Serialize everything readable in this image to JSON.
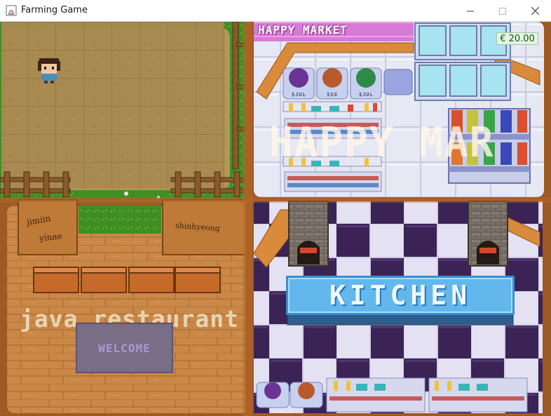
{
  "window": {
    "title": "Farming Game",
    "icon": "java-app-icon",
    "controls": [
      "minimize",
      "maximize",
      "close"
    ]
  },
  "hud": {
    "money": "€ 20.00"
  },
  "farm": {
    "grid_cols": 7,
    "grid_rows": 5,
    "player": "farmer-character"
  },
  "market": {
    "sign": "HAPPY MARKET",
    "overlay_label": "HAPPY MARKET",
    "overlay_visible": "HAPPY MAR",
    "price_tags": [
      "$JUL",
      "$SO",
      "$JUL"
    ]
  },
  "restaurant": {
    "overlay_label": "java restaurant",
    "welcome_mat": "WELCOME",
    "sign_left_line1": "jimiin",
    "sign_left_line2": "yinae",
    "sign_right": "shinhyeong"
  },
  "kitchen": {
    "sign": "KITCHEN"
  },
  "colors": {
    "grass": "#3f8f22",
    "soil": "#a88a52",
    "market_floor": "#e8eaf4",
    "wood_floor": "#c27a3a",
    "kitchen_sign": "#62b8ec",
    "money_text": "#0b5a0b"
  }
}
